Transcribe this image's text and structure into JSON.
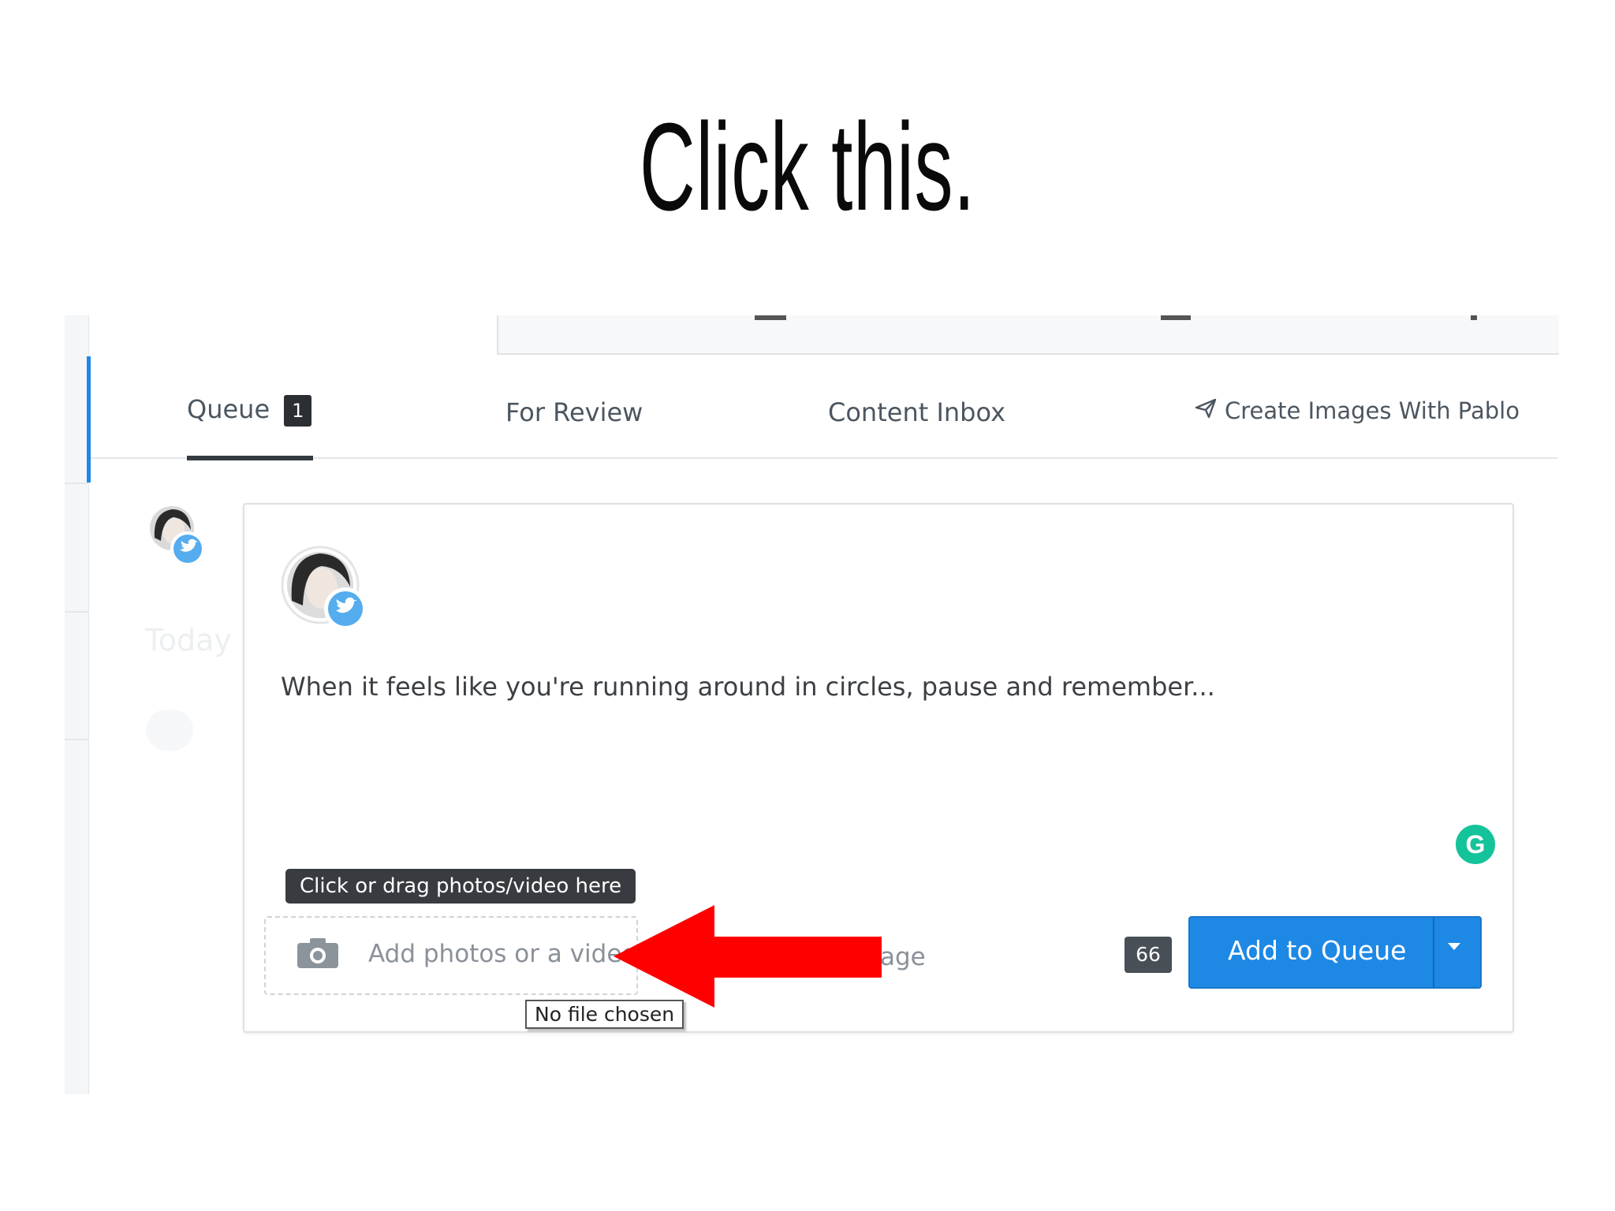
{
  "headline": "Click this.",
  "tabs": {
    "queue_label": "Queue",
    "queue_count": "1",
    "review_label": "For Review",
    "inbox_label": "Content Inbox",
    "pablo_label": "Create Images With Pablo"
  },
  "sidebar": {
    "day_label": "Today"
  },
  "composer": {
    "post_text": "When it feels like you're running around in circles, pause and remember...",
    "tooltip": "Click or drag photos/video here",
    "upload_label": "Add photos or a video",
    "obscured_text": "age",
    "file_input_status": "No file chosen",
    "char_count": "66",
    "submit_label": "Add to Queue",
    "grammarly_letter": "G"
  },
  "colors": {
    "accent_blue": "#1e88e5",
    "arrow_red": "#ff0000",
    "grammarly_green": "#15c39a",
    "twitter_blue": "#55acee"
  },
  "icons": {
    "camera": "camera-icon",
    "pablo": "paper-plane-icon",
    "caret": "caret-down-icon",
    "twitter": "twitter-bird-icon"
  }
}
